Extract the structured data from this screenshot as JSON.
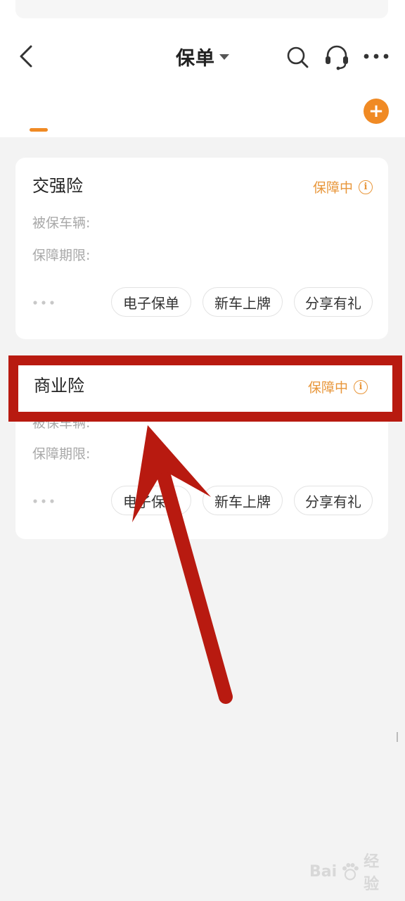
{
  "header": {
    "title": "保单"
  },
  "cards": [
    {
      "title": "交强险",
      "status": "保障中",
      "labels": [
        "被保车辆:",
        "保障期限:"
      ],
      "actions": [
        "电子保单",
        "新车上牌",
        "分享有礼"
      ]
    },
    {
      "title": "商业险",
      "status": "保障中",
      "labels": [
        "被保车辆:",
        "保障期限:"
      ],
      "actions": [
        "电子保单",
        "新车上牌",
        "分享有礼"
      ]
    }
  ],
  "highlight": {
    "title": "商业险",
    "status": "保障中"
  },
  "watermark": {
    "left": "Bai",
    "right": "经验"
  },
  "colors": {
    "accent": "#f08a24",
    "status": "#e8963a",
    "annotation": "#b81a10"
  }
}
